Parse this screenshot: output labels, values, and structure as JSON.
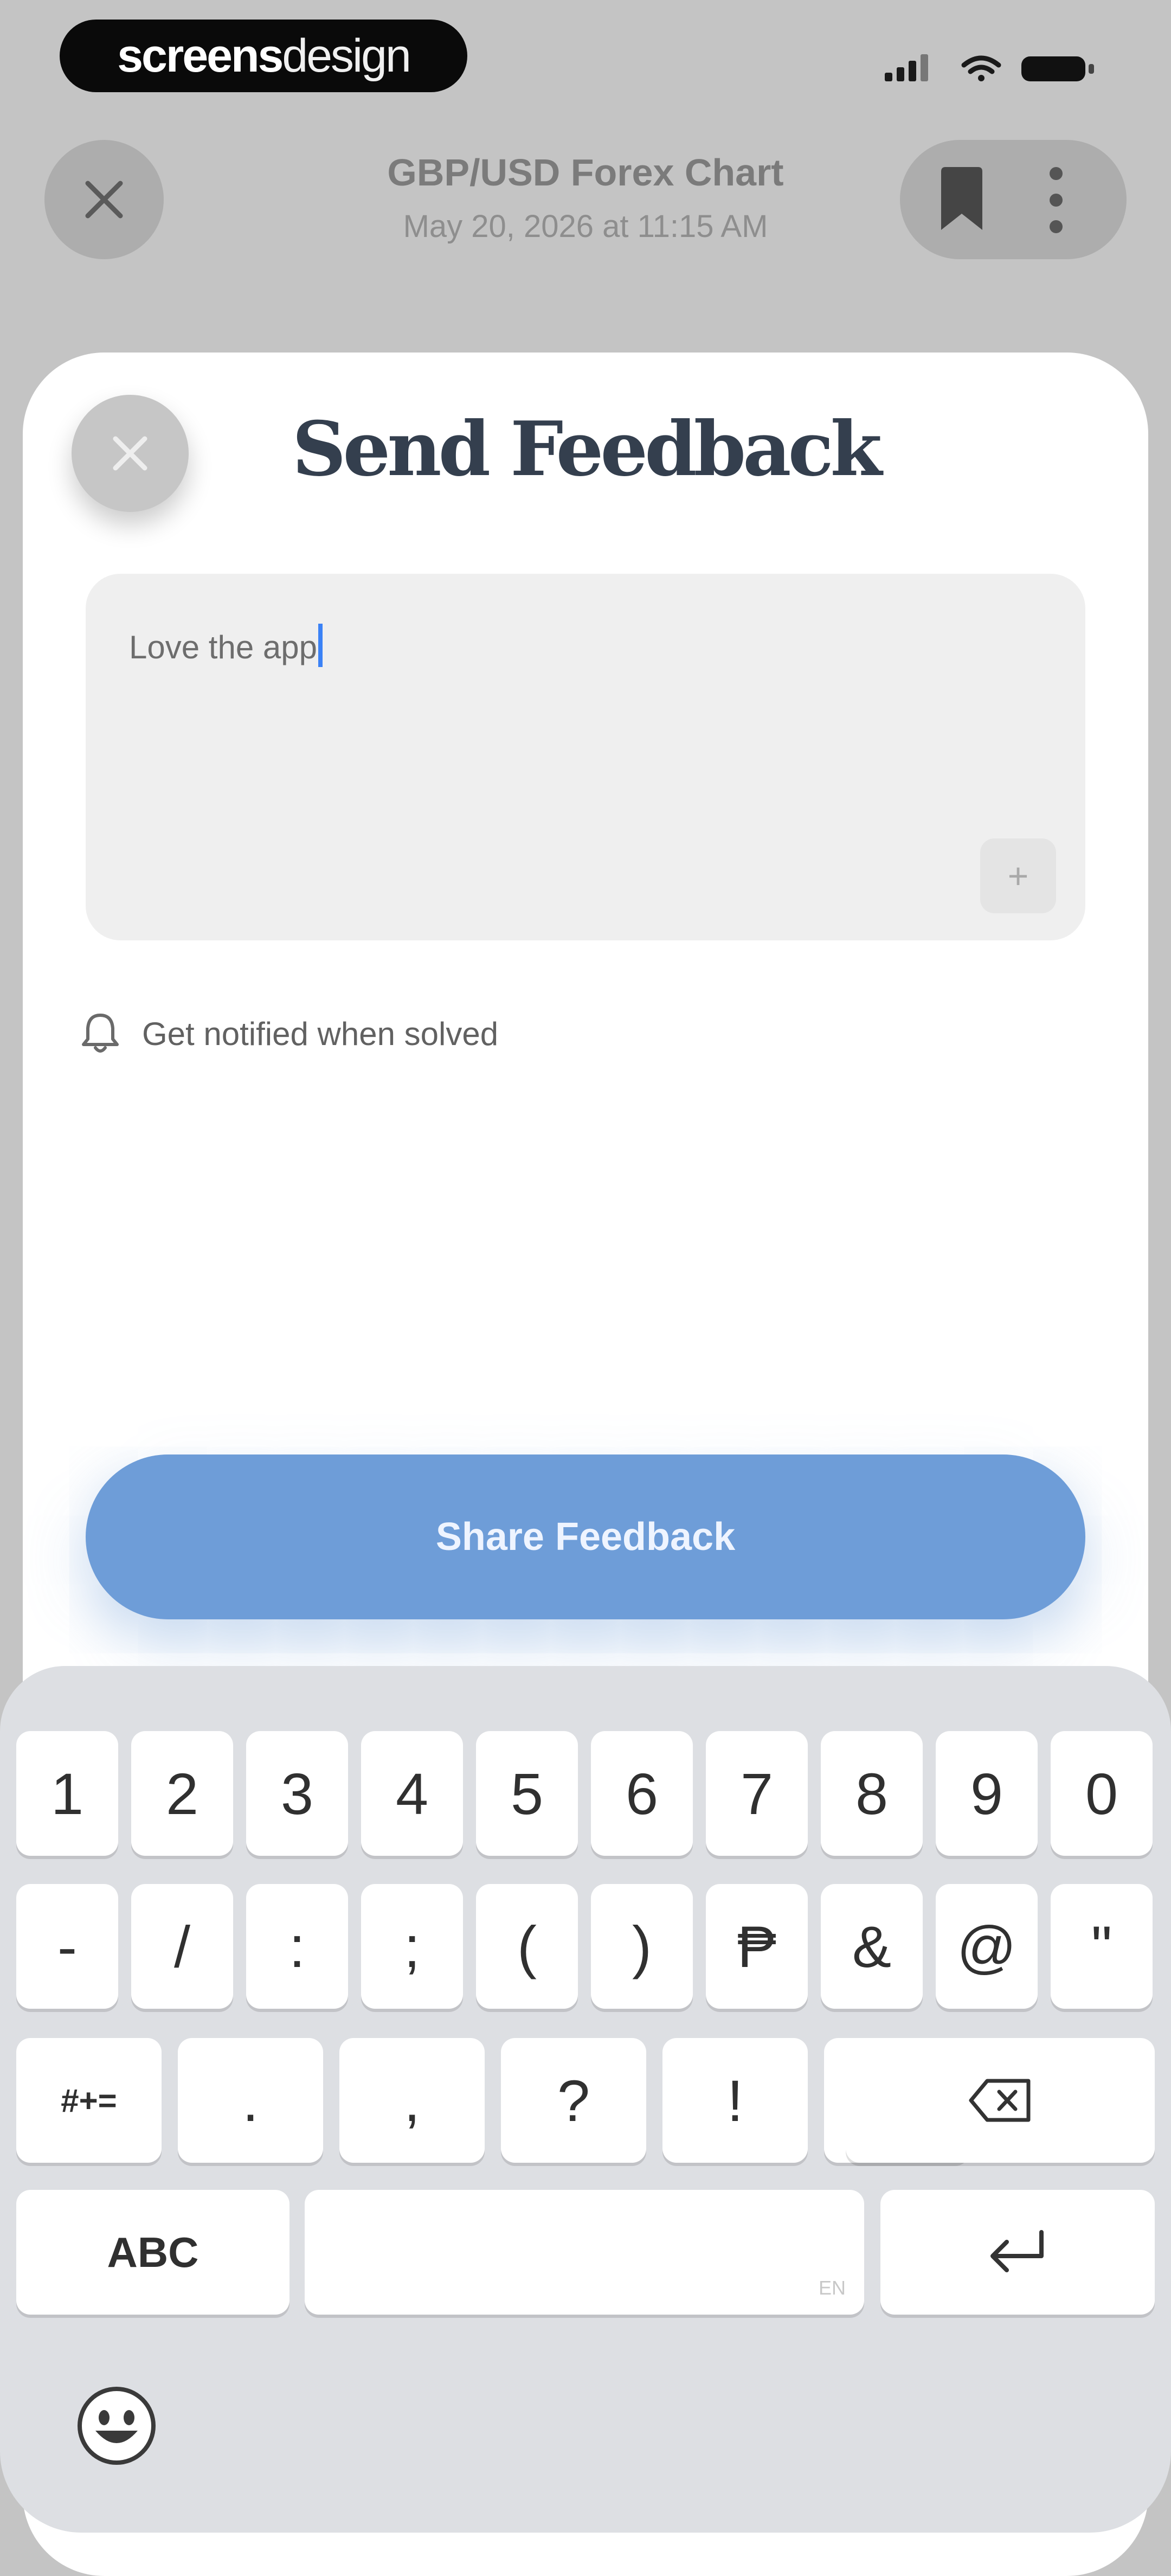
{
  "status_bar": {
    "brand_bold": "screens",
    "brand_light": "design",
    "icons": [
      "signal-icon",
      "wifi-icon",
      "battery-icon"
    ]
  },
  "header": {
    "title": "GBP/USD Forex Chart",
    "subtitle": "May 20, 2026 at 11:15 AM",
    "actions": [
      "bookmark-icon",
      "more-vertical-icon"
    ]
  },
  "sheet": {
    "title": "Send Feedback",
    "feedback_value": "Love the app",
    "attach_label": "+",
    "notify_label": "Get notified when solved",
    "submit_label": "Share Feedback"
  },
  "keyboard": {
    "row1": [
      "1",
      "2",
      "3",
      "4",
      "5",
      "6",
      "7",
      "8",
      "9",
      "0"
    ],
    "row2": [
      "-",
      "/",
      ":",
      ";",
      "(",
      ")",
      "₱",
      "&",
      "@",
      "\""
    ],
    "row3": [
      "#+=",
      ".",
      ",",
      "?",
      "!",
      "'"
    ],
    "abc_label": "ABC",
    "space_hint": "EN",
    "icons": [
      "delete-icon",
      "return-icon",
      "emoji-icon"
    ]
  },
  "colors": {
    "accent": "#6e9dd8",
    "caret": "#3b82f6",
    "title": "#343f4e",
    "keyboard_bg": "#dddfe3"
  }
}
